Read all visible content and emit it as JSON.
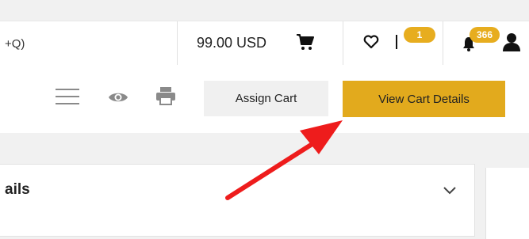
{
  "header": {
    "search_hint": "+Q)",
    "cart_total": "99.00 USD",
    "wishlist_badge": "1",
    "notification_badge": "366"
  },
  "toolbar": {
    "assign_cart_label": "Assign Cart",
    "view_cart_details_label": "View Cart Details"
  },
  "card": {
    "title": "ails"
  },
  "colors": {
    "accent": "#e2aa1d",
    "badge": "#e7ad1f",
    "annotation_arrow": "#ee1c1c"
  },
  "icons": [
    "search-icon",
    "cart-icon",
    "heart-icon",
    "flag-icon",
    "bell-icon",
    "user-icon",
    "menu-icon",
    "eye-icon",
    "print-icon",
    "chevron-down-icon"
  ]
}
